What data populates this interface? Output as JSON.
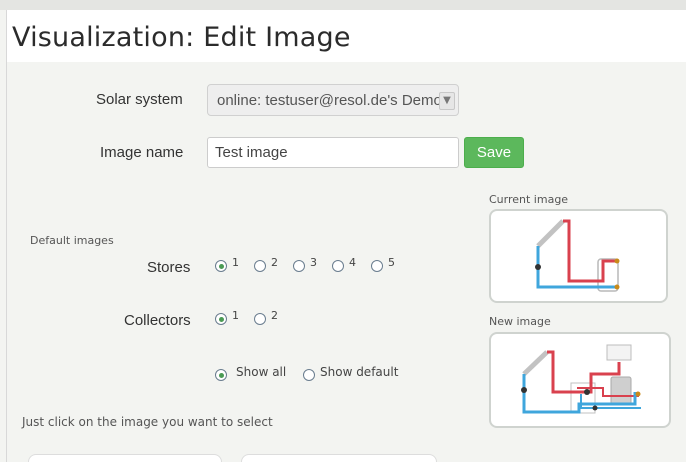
{
  "page": {
    "title": "Visualization: Edit Image"
  },
  "form": {
    "solar_system_label": "Solar system",
    "solar_system_value": "online:  testuser@resol.de's Demo",
    "image_name_label": "Image name",
    "image_name_value": "Test image",
    "save_label": "Save"
  },
  "defaults": {
    "heading": "Default images",
    "stores_label": "Stores",
    "stores_options": [
      "1",
      "2",
      "3",
      "4",
      "5"
    ],
    "stores_selected": "1",
    "collectors_label": "Collectors",
    "collectors_options": [
      "1",
      "2"
    ],
    "collectors_selected": "1",
    "show_all_label": "Show all",
    "show_default_label": "Show default",
    "show_selected": "Show all"
  },
  "hint": "Just click on the image you want to select",
  "preview": {
    "current_label": "Current image",
    "new_label": "New image"
  },
  "colors": {
    "hot_pipe": "#d9414e",
    "cold_pipe": "#3fa6dc",
    "save_green": "#5cb85c"
  }
}
